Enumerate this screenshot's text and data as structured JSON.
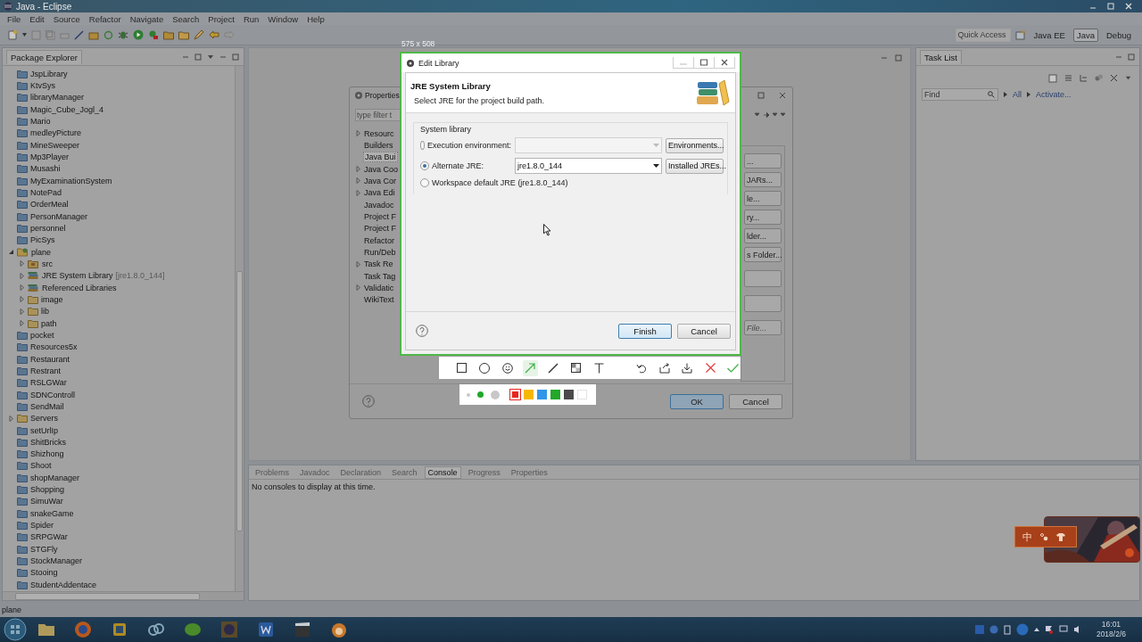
{
  "window": {
    "title": "Java - Eclipse"
  },
  "menu": [
    "File",
    "Edit",
    "Source",
    "Refactor",
    "Navigate",
    "Search",
    "Project",
    "Run",
    "Window",
    "Help"
  ],
  "toolbar": {
    "quick_access": {
      "placeholder": "Quick Access"
    },
    "perspectives": [
      {
        "label": "Java EE",
        "selected": false
      },
      {
        "label": "Java",
        "selected": true
      },
      {
        "label": "Debug",
        "selected": false
      }
    ]
  },
  "package_explorer": {
    "title": "Package Explorer",
    "items": [
      {
        "label": "JspLibrary",
        "kind": "project"
      },
      {
        "label": "KtvSys",
        "kind": "project"
      },
      {
        "label": "libraryManager",
        "kind": "project"
      },
      {
        "label": "Magic_Cube_Jogl_4",
        "kind": "project"
      },
      {
        "label": "Mario",
        "kind": "project"
      },
      {
        "label": "medleyPicture",
        "kind": "project"
      },
      {
        "label": "MineSweeper",
        "kind": "project"
      },
      {
        "label": "Mp3Player",
        "kind": "project"
      },
      {
        "label": "Musashi",
        "kind": "project"
      },
      {
        "label": "MyExaminationSystem",
        "kind": "project"
      },
      {
        "label": "NotePad",
        "kind": "project"
      },
      {
        "label": "OrderMeal",
        "kind": "project"
      },
      {
        "label": "PersonManager",
        "kind": "project"
      },
      {
        "label": "personnel",
        "kind": "project"
      },
      {
        "label": "PicSys",
        "kind": "project"
      },
      {
        "label": "plane",
        "kind": "open_project",
        "expanded": true,
        "children": [
          {
            "label": "src",
            "kind": "source",
            "expanded": false
          },
          {
            "label": "JRE System Library",
            "kind": "library",
            "decoration": "[jre1.8.0_144]",
            "expanded": false
          },
          {
            "label": "Referenced Libraries",
            "kind": "library",
            "expanded": false
          },
          {
            "label": "image",
            "kind": "folder",
            "expanded": false
          },
          {
            "label": "lib",
            "kind": "folder",
            "expanded": false
          },
          {
            "label": "path",
            "kind": "folder",
            "expanded": false
          }
        ]
      },
      {
        "label": "pocket",
        "kind": "project"
      },
      {
        "label": "Resources5x",
        "kind": "project"
      },
      {
        "label": "Restaurant",
        "kind": "project"
      },
      {
        "label": "Restrant",
        "kind": "project"
      },
      {
        "label": "RSLGWar",
        "kind": "project"
      },
      {
        "label": "SDNControll",
        "kind": "project"
      },
      {
        "label": "SendMail",
        "kind": "project"
      },
      {
        "label": "Servers",
        "kind": "folder",
        "expanded": false
      },
      {
        "label": "setUrlIp",
        "kind": "project"
      },
      {
        "label": "ShitBricks",
        "kind": "project"
      },
      {
        "label": "Shizhong",
        "kind": "project"
      },
      {
        "label": "Shoot",
        "kind": "project"
      },
      {
        "label": "shopManager",
        "kind": "project"
      },
      {
        "label": "Shopping",
        "kind": "project"
      },
      {
        "label": "SimuWar",
        "kind": "project"
      },
      {
        "label": "snakeGame",
        "kind": "project"
      },
      {
        "label": "Spider",
        "kind": "project"
      },
      {
        "label": "SRPGWar",
        "kind": "project"
      },
      {
        "label": "STGFly",
        "kind": "project"
      },
      {
        "label": "StockManager",
        "kind": "project"
      },
      {
        "label": "Stooing",
        "kind": "project"
      },
      {
        "label": "StudentAddentace",
        "kind": "project"
      }
    ]
  },
  "task_list": {
    "title": "Task List",
    "find": {
      "placeholder": "Find"
    },
    "links": [
      "All",
      "Activate..."
    ]
  },
  "console": {
    "tabs": [
      {
        "label": "Problems",
        "selected": false
      },
      {
        "label": "Javadoc",
        "selected": false
      },
      {
        "label": "Declaration",
        "selected": false
      },
      {
        "label": "Search",
        "selected": false
      },
      {
        "label": "Console",
        "selected": true
      },
      {
        "label": "Progress",
        "selected": false
      },
      {
        "label": "Properties",
        "selected": false
      }
    ],
    "message": "No consoles to display at this time."
  },
  "properties_dialog": {
    "title": "Properties",
    "filter": {
      "placeholder": "type filter t"
    },
    "tree": [
      {
        "label": "Resourc",
        "expanded": false,
        "selected": false
      },
      {
        "label": "Builders",
        "selected": false
      },
      {
        "label": "Java Bui",
        "selected": true
      },
      {
        "label": "Java Coo",
        "expanded": false,
        "selected": false
      },
      {
        "label": "Java Cor",
        "expanded": false,
        "selected": false
      },
      {
        "label": "Java Edi",
        "expanded": false,
        "selected": false
      },
      {
        "label": "Javadoc",
        "selected": false
      },
      {
        "label": "Project F",
        "selected": false
      },
      {
        "label": "Project F",
        "selected": false
      },
      {
        "label": "Refactor",
        "selected": false
      },
      {
        "label": "Run/Deb",
        "selected": false
      },
      {
        "label": "Task Re",
        "expanded": false,
        "selected": false
      },
      {
        "label": "Task Tag",
        "selected": false
      },
      {
        "label": "Validatic",
        "expanded": false,
        "selected": false
      },
      {
        "label": "WikiText",
        "selected": false
      }
    ],
    "side_buttons": [
      {
        "kind": "button",
        "label": "...",
        "disabled": false
      },
      {
        "kind": "button",
        "label": "JARs...",
        "disabled": false
      },
      {
        "kind": "button",
        "label": "le...",
        "disabled": false
      },
      {
        "kind": "button",
        "label": "ry...",
        "disabled": false
      },
      {
        "kind": "button",
        "label": "lder...",
        "disabled": false
      },
      {
        "kind": "button",
        "label": "s Folder...",
        "disabled": false
      },
      {
        "kind": "blank"
      },
      {
        "kind": "blank"
      },
      {
        "kind": "button",
        "label": "File...",
        "disabled": true
      }
    ],
    "buttons": [
      "OK",
      "Cancel"
    ]
  },
  "capture": {
    "size_label": "575 x 508",
    "tools": [
      {
        "kind": "rectangle",
        "selected": false
      },
      {
        "kind": "ellipse",
        "selected": false
      },
      {
        "kind": "emoji",
        "selected": false
      },
      {
        "kind": "arrow",
        "selected": true
      },
      {
        "kind": "pen",
        "selected": false
      },
      {
        "kind": "mosaic",
        "selected": false
      },
      {
        "kind": "text",
        "selected": false
      },
      {
        "kind": "undo",
        "selected": false
      },
      {
        "kind": "share",
        "selected": false
      },
      {
        "kind": "save",
        "selected": false
      },
      {
        "kind": "cancel",
        "selected": false
      },
      {
        "kind": "confirm",
        "selected": false
      }
    ],
    "sizes": [
      {
        "selected": false
      },
      {
        "selected": true
      },
      {
        "selected": false
      }
    ],
    "colors": [
      {
        "color": "#e8261e",
        "selected": true
      },
      {
        "color": "#f5b800",
        "selected": false
      },
      {
        "color": "#2f96e8",
        "selected": false
      },
      {
        "color": "#22a82a",
        "selected": false
      },
      {
        "color": "#4a4a4a",
        "selected": false
      },
      {
        "color": "#ffffff",
        "selected": false
      }
    ]
  },
  "edit_library": {
    "title": "Edit Library",
    "heading": "JRE System Library",
    "subtitle": "Select JRE for the project build path.",
    "group": "System library",
    "options": [
      {
        "label": "Execution environment:",
        "selected": false,
        "combo": {
          "disabled": true
        },
        "button": "Environments..."
      },
      {
        "label": "Alternate JRE:",
        "selected": true,
        "combo": {
          "value": "jre1.8.0_144",
          "disabled": false
        },
        "button": "Installed JREs..."
      },
      {
        "label": "Workspace default JRE (jre1.8.0_144)",
        "selected": false
      }
    ],
    "buttons": [
      {
        "label": "Finish",
        "default": true
      },
      {
        "label": "Cancel",
        "default": false
      }
    ]
  },
  "widget": {
    "label": "中"
  },
  "status_bar": "plane",
  "taskbar": {
    "time": "16:01",
    "date": "2018/2/6"
  }
}
